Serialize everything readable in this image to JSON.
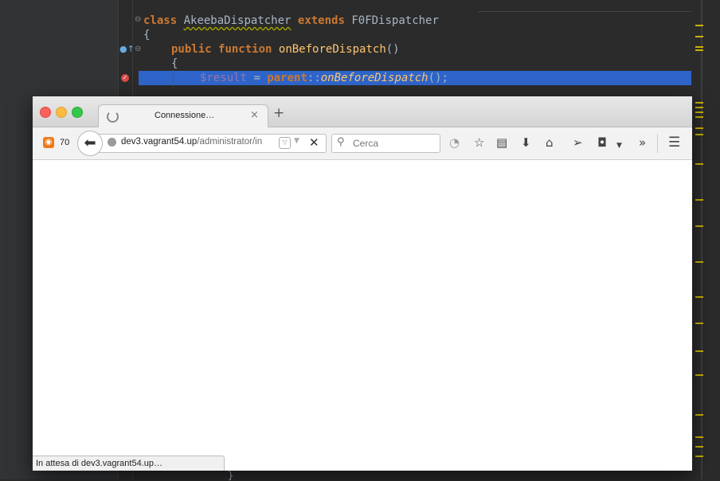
{
  "ide": {
    "lines": {
      "l1_kw1": "class",
      "l1_cls": "AkeebaDispatcher",
      "l1_kw2": "extends",
      "l1_parent": "F0FDispatcher",
      "l2": "{",
      "l3_kw1": "public",
      "l3_kw2": "function",
      "l3_fn": "onBeforeDispatch",
      "l3_paren": "()",
      "l4": "{",
      "l5_var": "$result",
      "l5_eq": " = ",
      "l5_kw": "parent",
      "l5_op": "::",
      "l5_fn": "onBeforeDispatch",
      "l5_end": "();"
    },
    "bottom_brace": "}"
  },
  "browser": {
    "tab": {
      "title": "Connessione…",
      "close": "×"
    },
    "new_tab": "+",
    "rss": {
      "count": "70"
    },
    "url": {
      "host": "dev3.vagrant54.up",
      "path": "/administrator/in"
    },
    "search": {
      "placeholder": "Cerca"
    },
    "status": "In attesa di dev3.vagrant54.up…"
  },
  "icons": {
    "back": "back-arrow-icon",
    "stop": "stop-icon",
    "feed": "rss-icon",
    "bookmark": "star-icon",
    "reading_list": "clipboard-icon",
    "downloads": "download-icon",
    "home": "home-icon",
    "send": "send-icon",
    "pocket": "pocket-icon",
    "overflow": "chevron-double-right-icon",
    "menu": "hamburger-menu-icon"
  }
}
